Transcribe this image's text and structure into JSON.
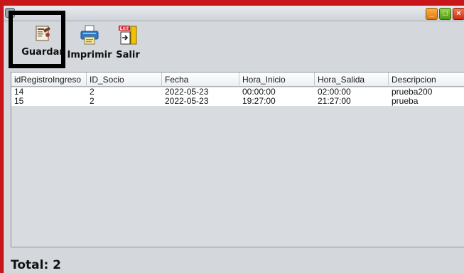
{
  "window": {
    "controls": {
      "minimize": "_",
      "maximize": "□",
      "close": "×"
    }
  },
  "toolbar": {
    "guardar_label": "Guardar",
    "imprimir_label": "Imprimir",
    "salir_label": "Salir",
    "exit_sign": "EXIT"
  },
  "table": {
    "columns": [
      "idRegistroIngreso",
      "ID_Socio",
      "Fecha",
      "Hora_Inicio",
      "Hora_Salida",
      "Descripcion"
    ],
    "rows": [
      [
        "14",
        "2",
        "2022-05-23",
        "00:00:00",
        "02:00:00",
        "prueba200"
      ],
      [
        "15",
        "2",
        "2022-05-23",
        "19:27:00",
        "21:27:00",
        "prueba"
      ]
    ]
  },
  "footer": {
    "total": "Total: 2"
  },
  "colors": {
    "frame": "#c8161a",
    "window_bg": "#d4d7dc"
  }
}
